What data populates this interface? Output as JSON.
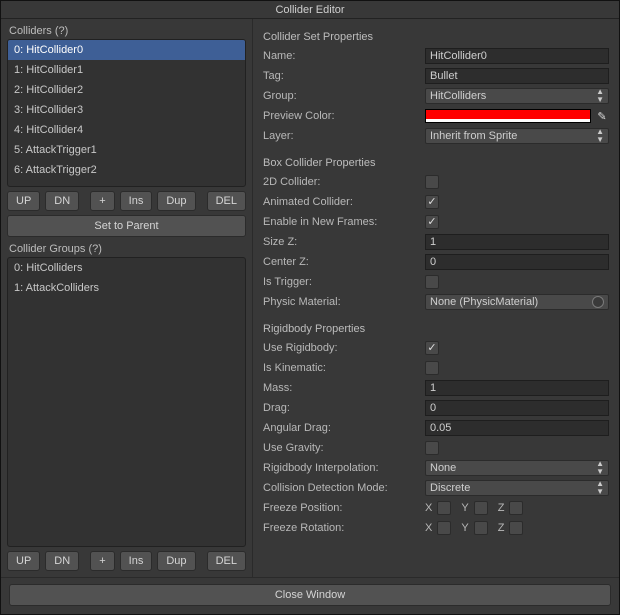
{
  "window": {
    "title": "Collider Editor"
  },
  "left": {
    "colliders_label": "Colliders (?)",
    "colliders": [
      "0: HitCollider0",
      "1: HitCollider1",
      "2: HitCollider2",
      "3: HitCollider3",
      "4: HitCollider4",
      "5: AttackTrigger1",
      "6: AttackTrigger2"
    ],
    "colliders_selected_index": 0,
    "groups_label": "Collider Groups (?)",
    "groups": [
      "0: HitColliders",
      "1: AttackColliders"
    ],
    "buttons": {
      "up": "UP",
      "dn": "DN",
      "plus": "+",
      "ins": "Ins",
      "dup": "Dup",
      "del": "DEL",
      "set_to_parent": "Set to Parent"
    }
  },
  "right": {
    "set_props_title": "Collider Set Properties",
    "set": {
      "name_label": "Name:",
      "name_value": "HitCollider0",
      "tag_label": "Tag:",
      "tag_value": "Bullet",
      "group_label": "Group:",
      "group_value": "HitColliders",
      "preview_color_label": "Preview Color:",
      "preview_color": "#ff0000",
      "layer_label": "Layer:",
      "layer_value": "Inherit from Sprite"
    },
    "box_props_title": "Box Collider Properties",
    "box": {
      "is2d_label": "2D Collider:",
      "is2d_checked": false,
      "anim_label": "Animated Collider:",
      "anim_checked": true,
      "enable_label": "Enable in New Frames:",
      "enable_checked": true,
      "sizez_label": "Size Z:",
      "sizez_value": "1",
      "centerz_label": "Center Z:",
      "centerz_value": "0",
      "trigger_label": "Is Trigger:",
      "trigger_checked": false,
      "physmat_label": "Physic Material:",
      "physmat_value": "None (PhysicMaterial)"
    },
    "rb_props_title": "Rigidbody Properties",
    "rb": {
      "use_label": "Use Rigidbody:",
      "use_checked": true,
      "kine_label": "Is Kinematic:",
      "kine_checked": false,
      "mass_label": "Mass:",
      "mass_value": "1",
      "drag_label": "Drag:",
      "drag_value": "0",
      "adrag_label": "Angular Drag:",
      "adrag_value": "0.05",
      "grav_label": "Use Gravity:",
      "grav_checked": false,
      "interp_label": "Rigidbody Interpolation:",
      "interp_value": "None",
      "cdm_label": "Collision Detection Mode:",
      "cdm_value": "Discrete",
      "fpos_label": "Freeze Position:",
      "frot_label": "Freeze Rotation:",
      "axis_x": "X",
      "axis_y": "Y",
      "axis_z": "Z",
      "fpos_x": false,
      "fpos_y": false,
      "fpos_z": false,
      "frot_x": false,
      "frot_y": false,
      "frot_z": false
    }
  },
  "footer": {
    "close": "Close Window"
  }
}
